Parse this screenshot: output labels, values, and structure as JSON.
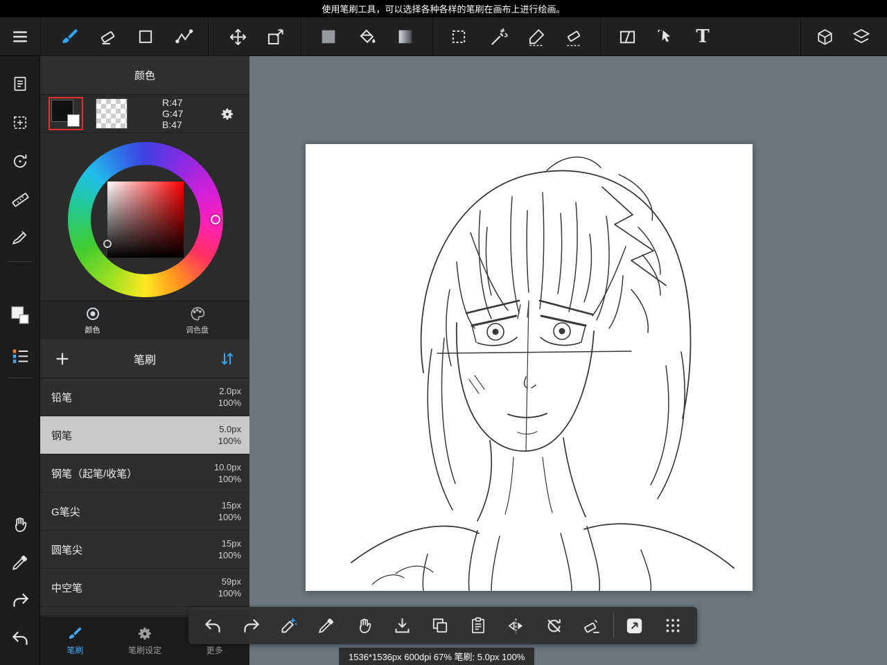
{
  "hint_bar": {
    "text": "使用笔刷工具，可以选择各种各样的笔刷在画布上进行绘画。"
  },
  "toolbar": {
    "text_tool_label": "T",
    "tools": [
      "menu",
      "brush",
      "eraser",
      "rectangle",
      "control-point-pen",
      "move",
      "transform",
      "current-color-swatch",
      "fill-bucket",
      "gradient",
      "select-rectangle",
      "magic-wand",
      "select-pen",
      "select-eraser",
      "divide-panel",
      "select-cursor",
      "text",
      "materials",
      "layers"
    ]
  },
  "sidebar": {
    "tools": [
      "pages",
      "select-move",
      "rotate-view",
      "ruler",
      "draw-tool",
      "current-color",
      "brush-list",
      "hand",
      "eyedropper",
      "redo",
      "undo"
    ]
  },
  "color_panel": {
    "title": "颜色",
    "rgb": {
      "r": "R:47",
      "g": "G:47",
      "b": "B:47"
    },
    "tabs": [
      {
        "label": "颜色",
        "selected": true
      },
      {
        "label": "调色盘",
        "selected": false
      }
    ]
  },
  "brush_panel": {
    "title": "笔刷",
    "brushes": [
      {
        "name": "铅笔",
        "size": "2.0px",
        "opacity": "100%",
        "selected": false
      },
      {
        "name": "钢笔",
        "size": "5.0px",
        "opacity": "100%",
        "selected": true
      },
      {
        "name": "钢笔（起笔/收笔）",
        "size": "10.0px",
        "opacity": "100%",
        "selected": false
      },
      {
        "name": "G笔尖",
        "size": "15px",
        "opacity": "100%",
        "selected": false
      },
      {
        "name": "圆笔尖",
        "size": "15px",
        "opacity": "100%",
        "selected": false
      },
      {
        "name": "中空笔",
        "size": "59px",
        "opacity": "100%",
        "selected": false
      }
    ],
    "footer_tabs": [
      {
        "label": "笔刷",
        "selected": true
      },
      {
        "label": "笔刷设定",
        "selected": false
      },
      {
        "label": "更多",
        "selected": false
      }
    ]
  },
  "floating_toolbar": {
    "tools": [
      "undo",
      "redo",
      "correction-pen",
      "eyedropper",
      "hand",
      "save",
      "copy",
      "paste",
      "flip-horizontal",
      "reset-rotation",
      "clear",
      "open-window",
      "grid"
    ]
  },
  "status_bar": {
    "text": "1536*1536px 600dpi 67% 笔刷: 5.0px 100%"
  },
  "colors": {
    "accent_blue": "#2fa3f7",
    "selection_red": "#e03030",
    "canvas_bg": "#6c767f",
    "panel_bg": "#2b2b2b",
    "toolbar_bg": "#212121",
    "selected_brush_bg": "#c9c9c9",
    "current_color_rgb": "rgb(47,47,47)"
  }
}
